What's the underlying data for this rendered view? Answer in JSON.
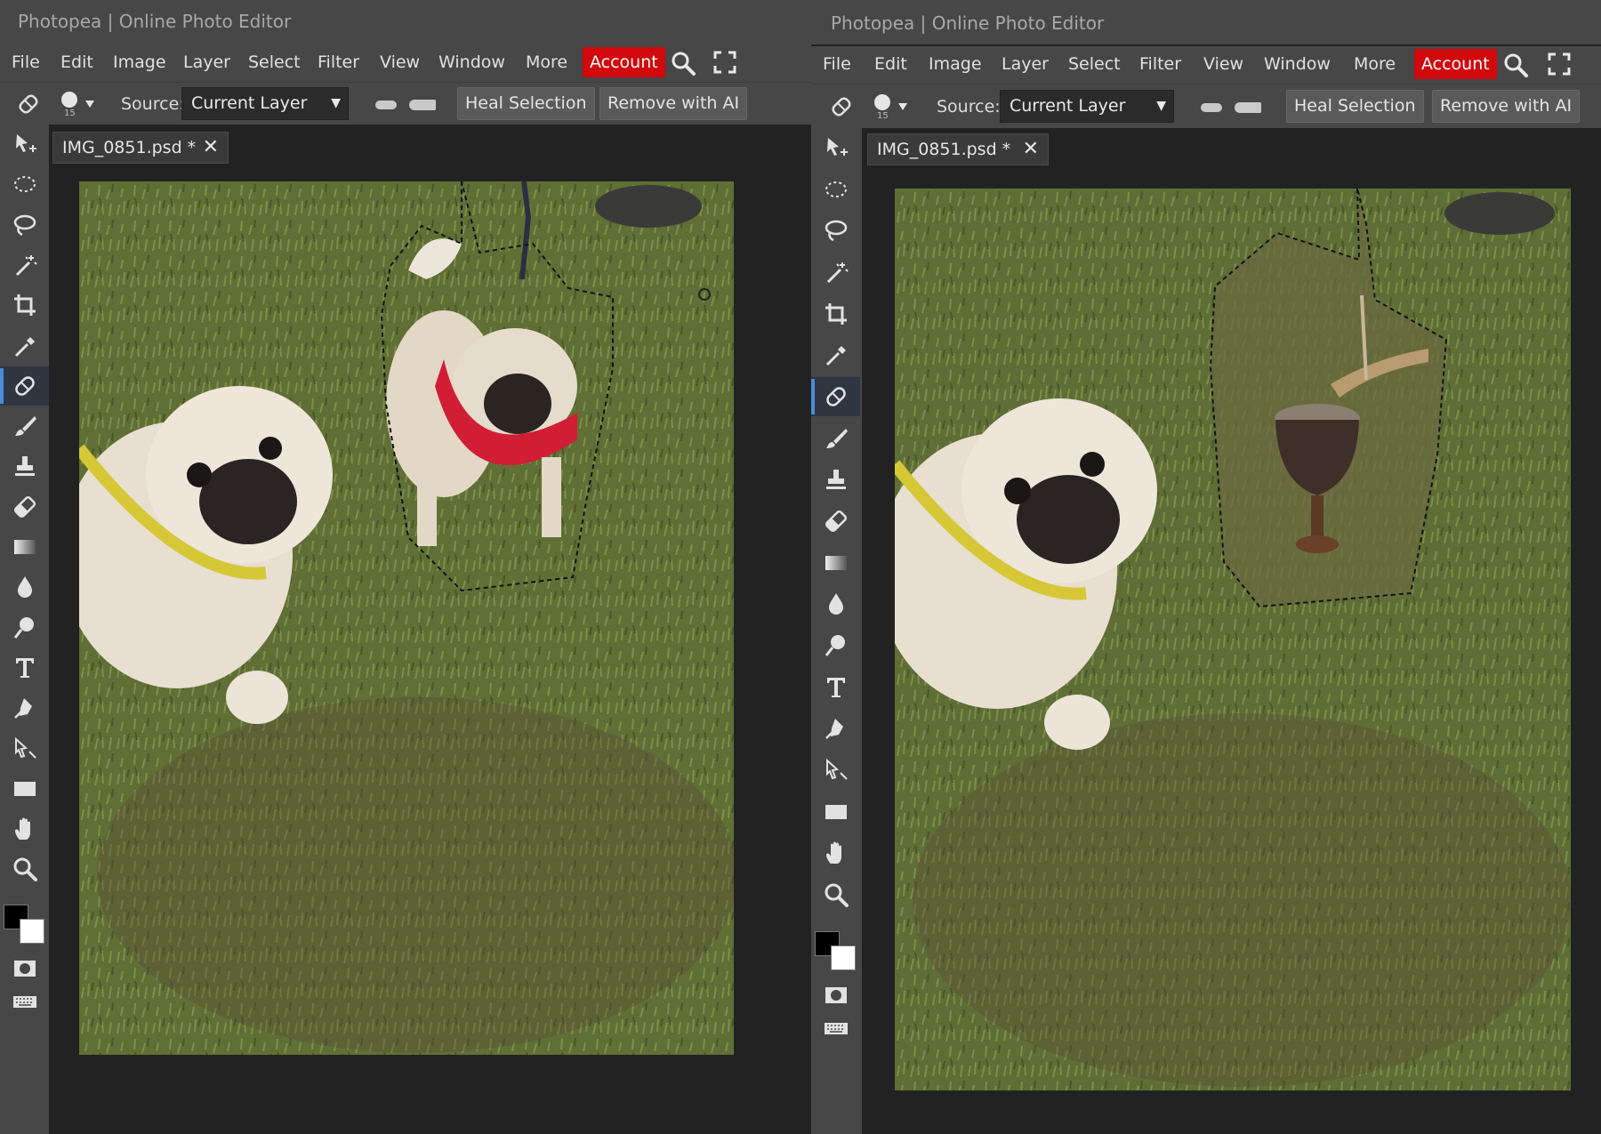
{
  "app": {
    "window_title": "Photopea | Online Photo Editor",
    "menu": [
      "File",
      "Edit",
      "Image",
      "Layer",
      "Select",
      "Filter",
      "View",
      "Window",
      "More"
    ],
    "account_label": "Account",
    "accent_color": "#d1080c"
  },
  "options_bar": {
    "brush_size": "15",
    "source_label": "Source:",
    "source_value": "Current Layer",
    "heal_selection_label": "Heal Selection",
    "remove_ai_label": "Remove with AI"
  },
  "document": {
    "tab_name": "IMG_0851.psd *",
    "close_glyph": "✕"
  },
  "tools": [
    "move-tool-icon",
    "marquee-tool-icon",
    "lasso-tool-icon",
    "magic-wand-tool-icon",
    "crop-tool-icon",
    "eyedropper-tool-icon",
    "healing-brush-tool-icon",
    "brush-tool-icon",
    "clone-stamp-tool-icon",
    "eraser-tool-icon",
    "gradient-tool-icon",
    "blur-tool-icon",
    "dodge-tool-icon",
    "type-tool-icon",
    "pen-tool-icon",
    "path-select-tool-icon",
    "rectangle-tool-icon",
    "hand-tool-icon",
    "zoom-tool-icon"
  ],
  "active_tool": "healing-brush-tool-icon",
  "colors": {
    "foreground": "#000000",
    "background": "#ffffff"
  }
}
